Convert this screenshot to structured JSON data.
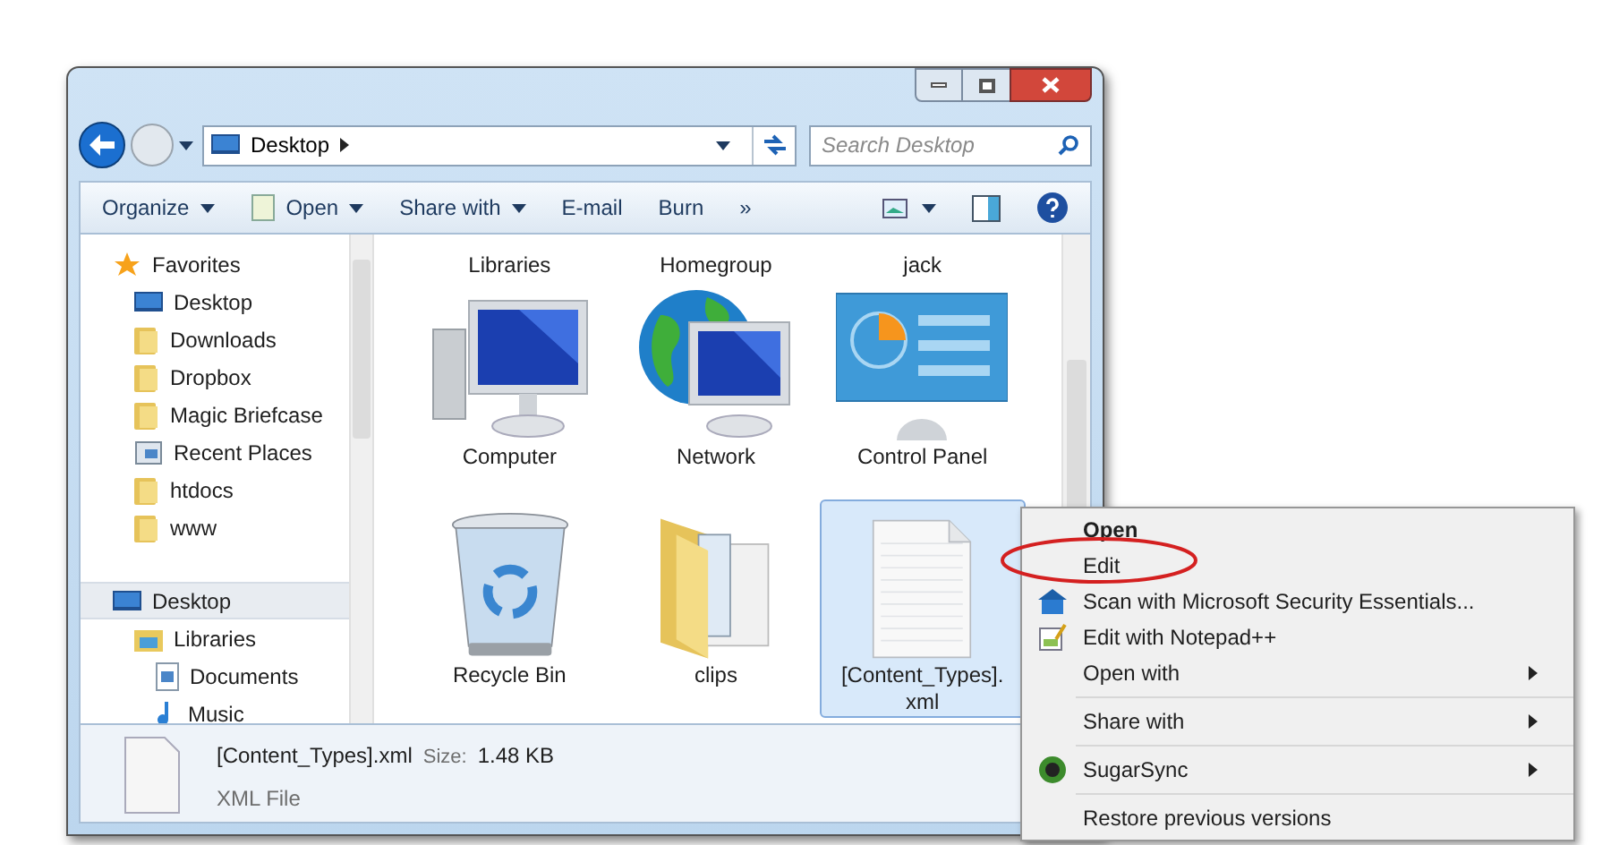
{
  "address_bar": {
    "location": "Desktop"
  },
  "search": {
    "placeholder": "Search Desktop"
  },
  "toolbar": [
    {
      "label": "Organize",
      "kind": "menu"
    },
    {
      "label": "Open",
      "kind": "open"
    },
    {
      "label": "Share with",
      "kind": "menu"
    },
    {
      "label": "E-mail",
      "kind": "plain"
    },
    {
      "label": "Burn",
      "kind": "plain"
    },
    {
      "label": "»",
      "kind": "plain"
    }
  ],
  "nav": [
    {
      "label": "Favorites",
      "kind": "star",
      "selected": false,
      "children": [
        {
          "label": "Desktop",
          "kind": "desktop",
          "selected": false
        },
        {
          "label": "Downloads",
          "kind": "folder",
          "selected": false
        },
        {
          "label": "Dropbox",
          "kind": "folder",
          "selected": false
        },
        {
          "label": "Magic Briefcase",
          "kind": "folder",
          "selected": false
        },
        {
          "label": "Recent Places",
          "kind": "recent",
          "selected": false
        },
        {
          "label": "htdocs",
          "kind": "folder",
          "selected": false
        },
        {
          "label": "www",
          "kind": "folder",
          "selected": false
        }
      ]
    },
    {
      "label": "Desktop",
      "kind": "desktop",
      "selected": true,
      "children": [
        {
          "label": "Libraries",
          "kind": "library",
          "selected": false,
          "children": [
            {
              "label": "Documents",
              "kind": "document",
              "selected": false
            },
            {
              "label": "Music",
              "kind": "music",
              "selected": false
            }
          ]
        }
      ]
    }
  ],
  "items": [
    {
      "label": "Libraries",
      "kind": "hidden",
      "selected": false
    },
    {
      "label": "Homegroup",
      "kind": "hidden",
      "selected": false
    },
    {
      "label": "jack",
      "kind": "hidden",
      "selected": false
    },
    {
      "label": "Computer",
      "kind": "computer",
      "selected": false
    },
    {
      "label": "Network",
      "kind": "network",
      "selected": false
    },
    {
      "label": "Control Panel",
      "kind": "panel",
      "selected": false
    },
    {
      "label": "Recycle Bin",
      "kind": "bin",
      "selected": false
    },
    {
      "label": "clips",
      "kind": "folder",
      "selected": false
    },
    {
      "label": "[Content_Types].xml",
      "kind": "file",
      "selected": true
    }
  ],
  "details": {
    "name": "[Content_Types].xml",
    "size_label": "Size:",
    "size": "1.48 KB",
    "type": "XML File"
  },
  "context_menu": [
    {
      "label": "Open",
      "kind": "plain",
      "default": true,
      "submenu": false
    },
    {
      "label": "Edit",
      "kind": "plain",
      "default": false,
      "submenu": false
    },
    {
      "label": "Scan with Microsoft Security Essentials...",
      "kind": "scanner",
      "default": false,
      "submenu": false
    },
    {
      "label": "Edit with Notepad++",
      "kind": "editor",
      "default": false,
      "submenu": false
    },
    {
      "label": "Open with",
      "kind": "plain",
      "default": false,
      "submenu": true
    },
    {
      "kind": "separator"
    },
    {
      "label": "Share with",
      "kind": "plain",
      "default": false,
      "submenu": true
    },
    {
      "kind": "separator"
    },
    {
      "label": "SugarSync",
      "kind": "sync",
      "default": false,
      "submenu": true
    },
    {
      "kind": "separator"
    },
    {
      "label": "Restore previous versions",
      "kind": "plain",
      "default": false,
      "submenu": false
    }
  ]
}
